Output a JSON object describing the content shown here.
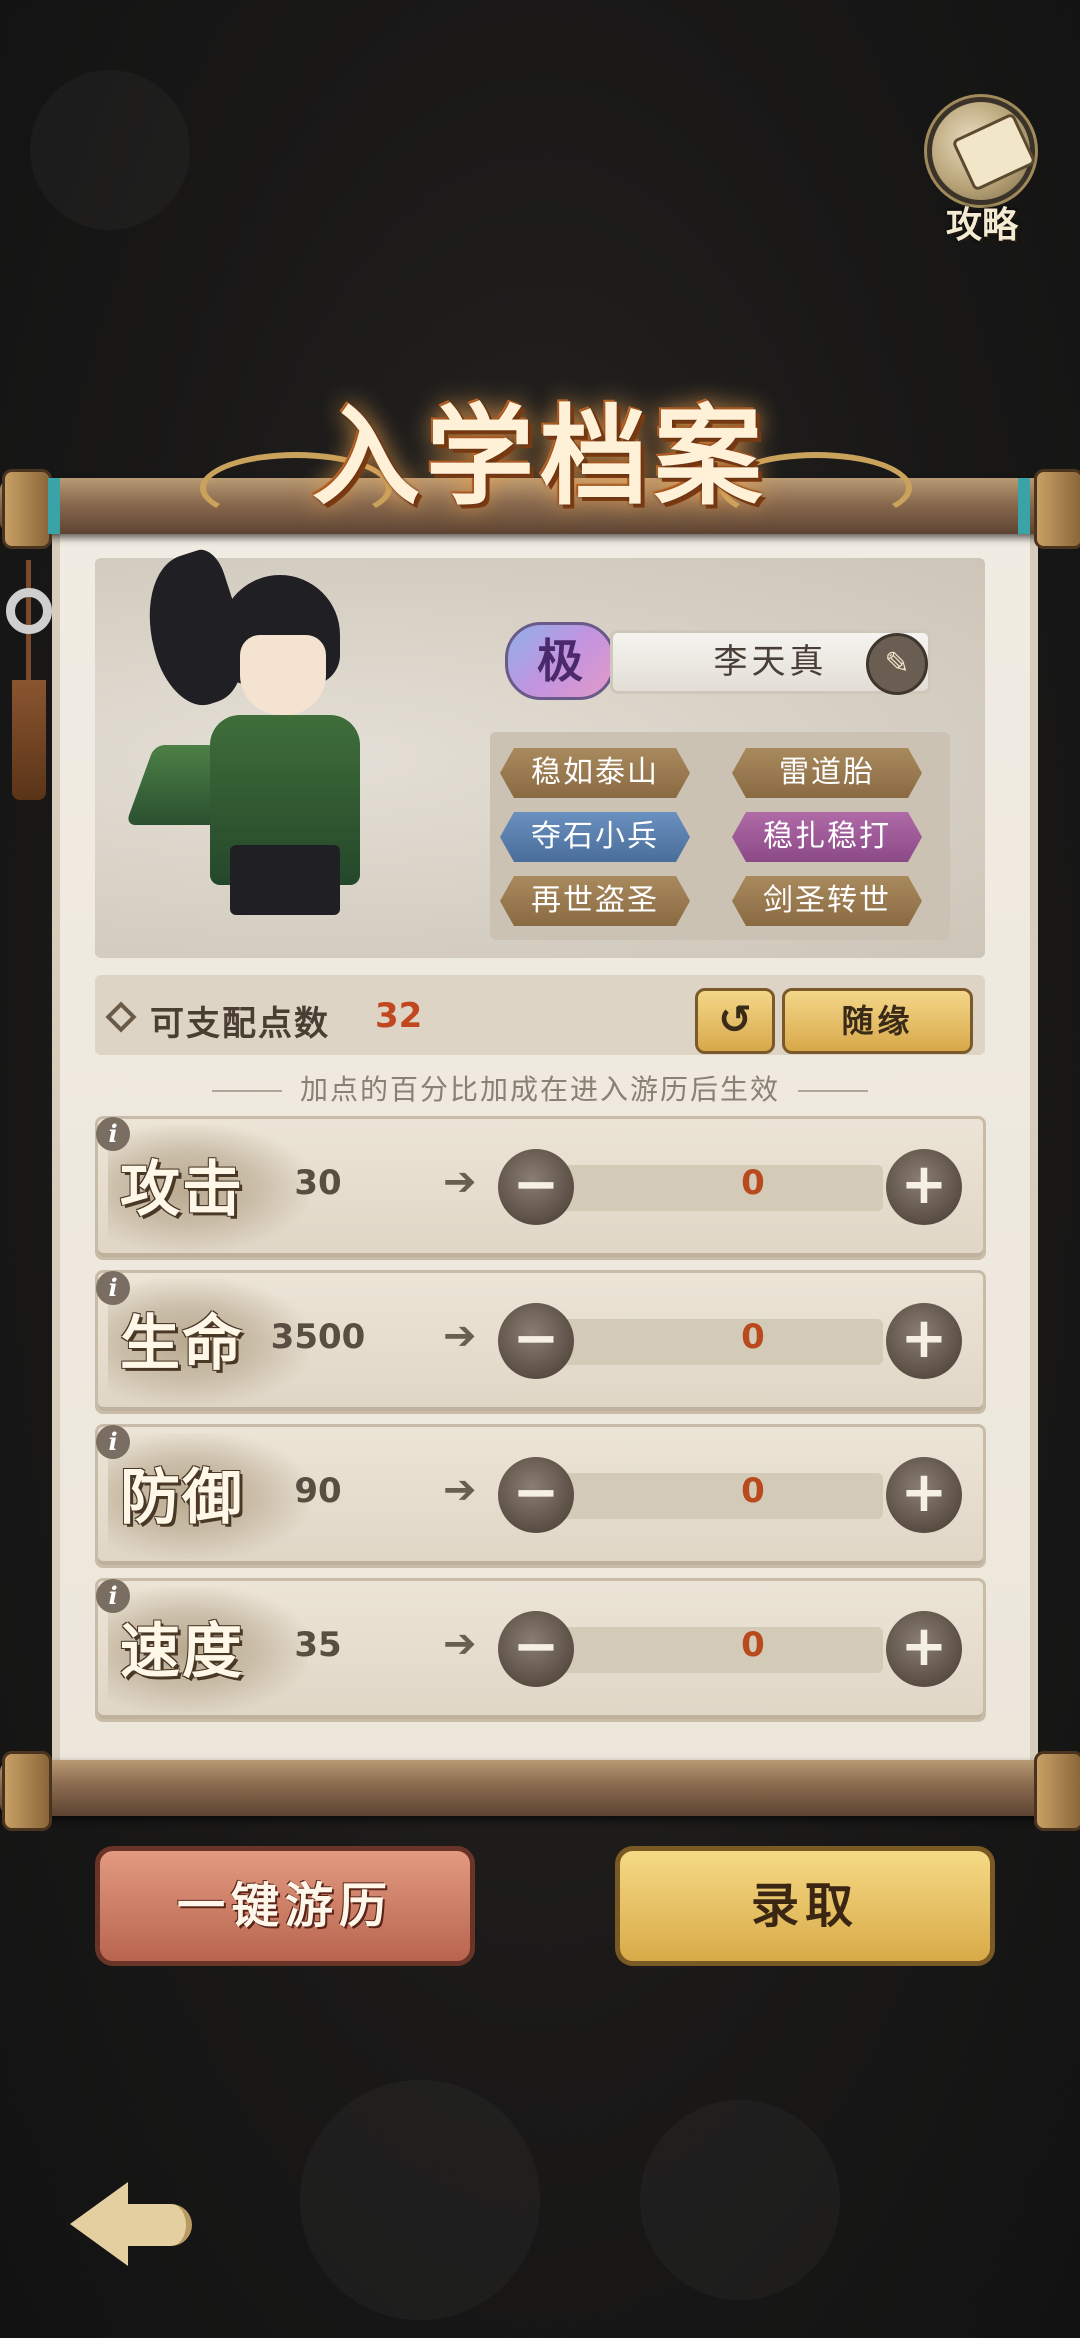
{
  "header": {
    "guide_label": "攻略"
  },
  "title": "入学档案",
  "character": {
    "rank": "极",
    "name": "李天真",
    "traits": [
      {
        "label": "稳如泰山",
        "tier": "gold"
      },
      {
        "label": "雷道胎",
        "tier": "gold"
      },
      {
        "label": "夺石小兵",
        "tier": "blue"
      },
      {
        "label": "稳扎稳打",
        "tier": "purple"
      },
      {
        "label": "再世盗圣",
        "tier": "gold"
      },
      {
        "label": "剑圣转世",
        "tier": "gold"
      }
    ]
  },
  "points": {
    "label": "可支配点数",
    "value": "32",
    "reset_icon": "undo-icon",
    "random_label": "随缘"
  },
  "hint": "加点的百分比加成在进入游历后生效",
  "stats": [
    {
      "name": "攻击",
      "base": "30",
      "new": "30",
      "added": "0"
    },
    {
      "name": "生命",
      "base": "3500",
      "new": "3500",
      "added": "0"
    },
    {
      "name": "防御",
      "base": "90",
      "new": "90",
      "added": "0"
    },
    {
      "name": "速度",
      "base": "35",
      "new": "35",
      "added": "0"
    }
  ],
  "actions": {
    "tour_label": "一键游历",
    "admit_label": "录取"
  },
  "colors": {
    "accent_red": "#b84a1e",
    "gold": "#d8aa48",
    "rank_purple": "#c294e0"
  }
}
